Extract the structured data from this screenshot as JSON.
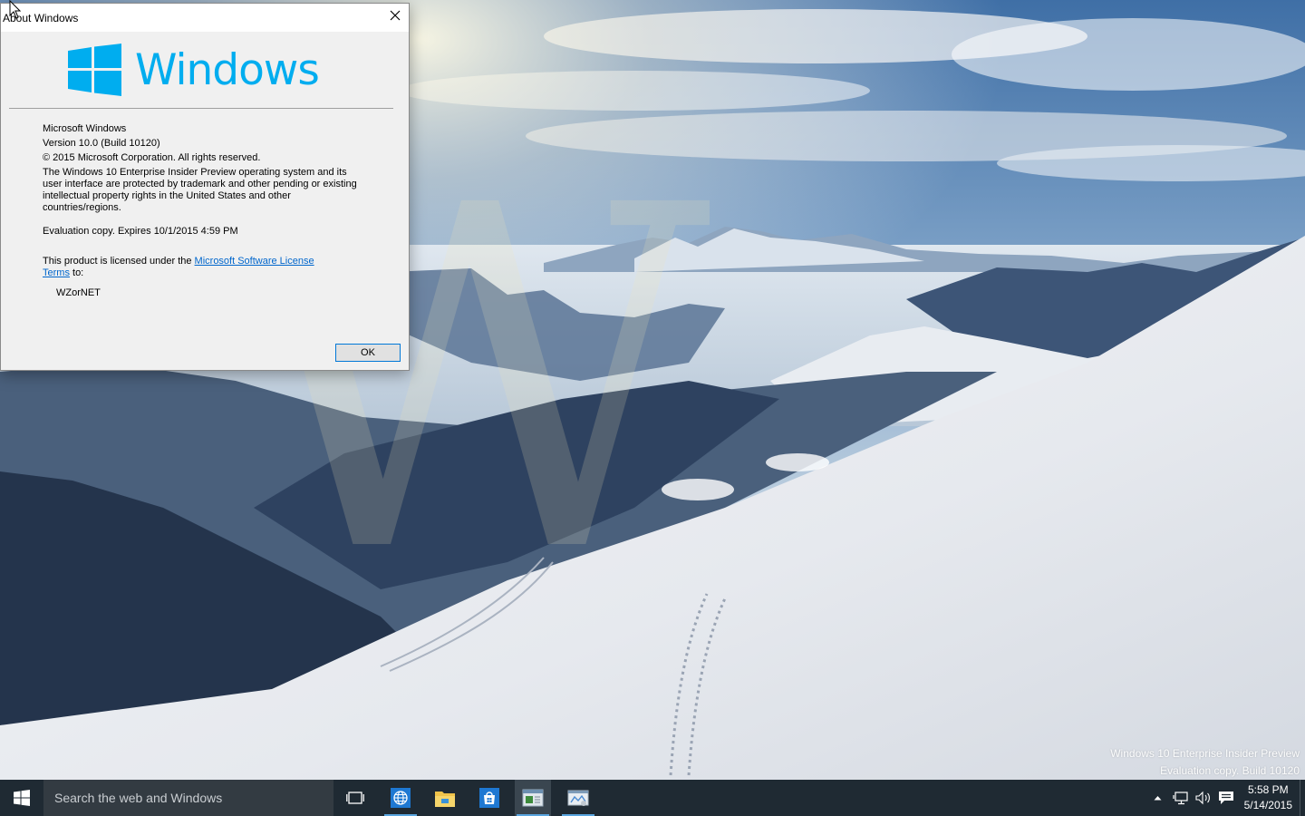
{
  "dialog": {
    "title": "About Windows",
    "logo_text": "Windows",
    "product": "Microsoft Windows",
    "version": "Version 10.0 (Build 10120)",
    "copyright": "© 2015 Microsoft Corporation. All rights reserved.",
    "description": "The Windows 10 Enterprise Insider Preview operating system and its user interface are protected by trademark and other pending or existing intellectual property rights in the United States and other countries/regions.",
    "evaluation": "Evaluation copy. Expires 10/1/2015 4:59 PM",
    "license_prefix": "This product is licensed under the ",
    "license_link": "Microsoft Software License Terms",
    "license_suffix": " to:",
    "licensee": "WZorNET",
    "ok_label": "OK"
  },
  "desktop": {
    "watermark_line1": "Windows 10 Enterprise Insider Preview",
    "watermark_line2": "Evaluation copy. Build 10120"
  },
  "taskbar": {
    "search_placeholder": "Search the web and Windows",
    "apps": [
      {
        "name": "task-view",
        "icon": "task-view-icon"
      },
      {
        "name": "internet-explorer",
        "icon": "globe-icon"
      },
      {
        "name": "file-explorer",
        "icon": "folder-icon"
      },
      {
        "name": "store",
        "icon": "store-bag-icon"
      },
      {
        "name": "system-window",
        "icon": "window-app-icon"
      },
      {
        "name": "winver",
        "icon": "about-app-icon"
      }
    ],
    "time": "5:58 PM",
    "date": "5/14/2015"
  },
  "colors": {
    "accent": "#00adef",
    "taskbar": "#1f2a33",
    "link": "#0066cc"
  }
}
